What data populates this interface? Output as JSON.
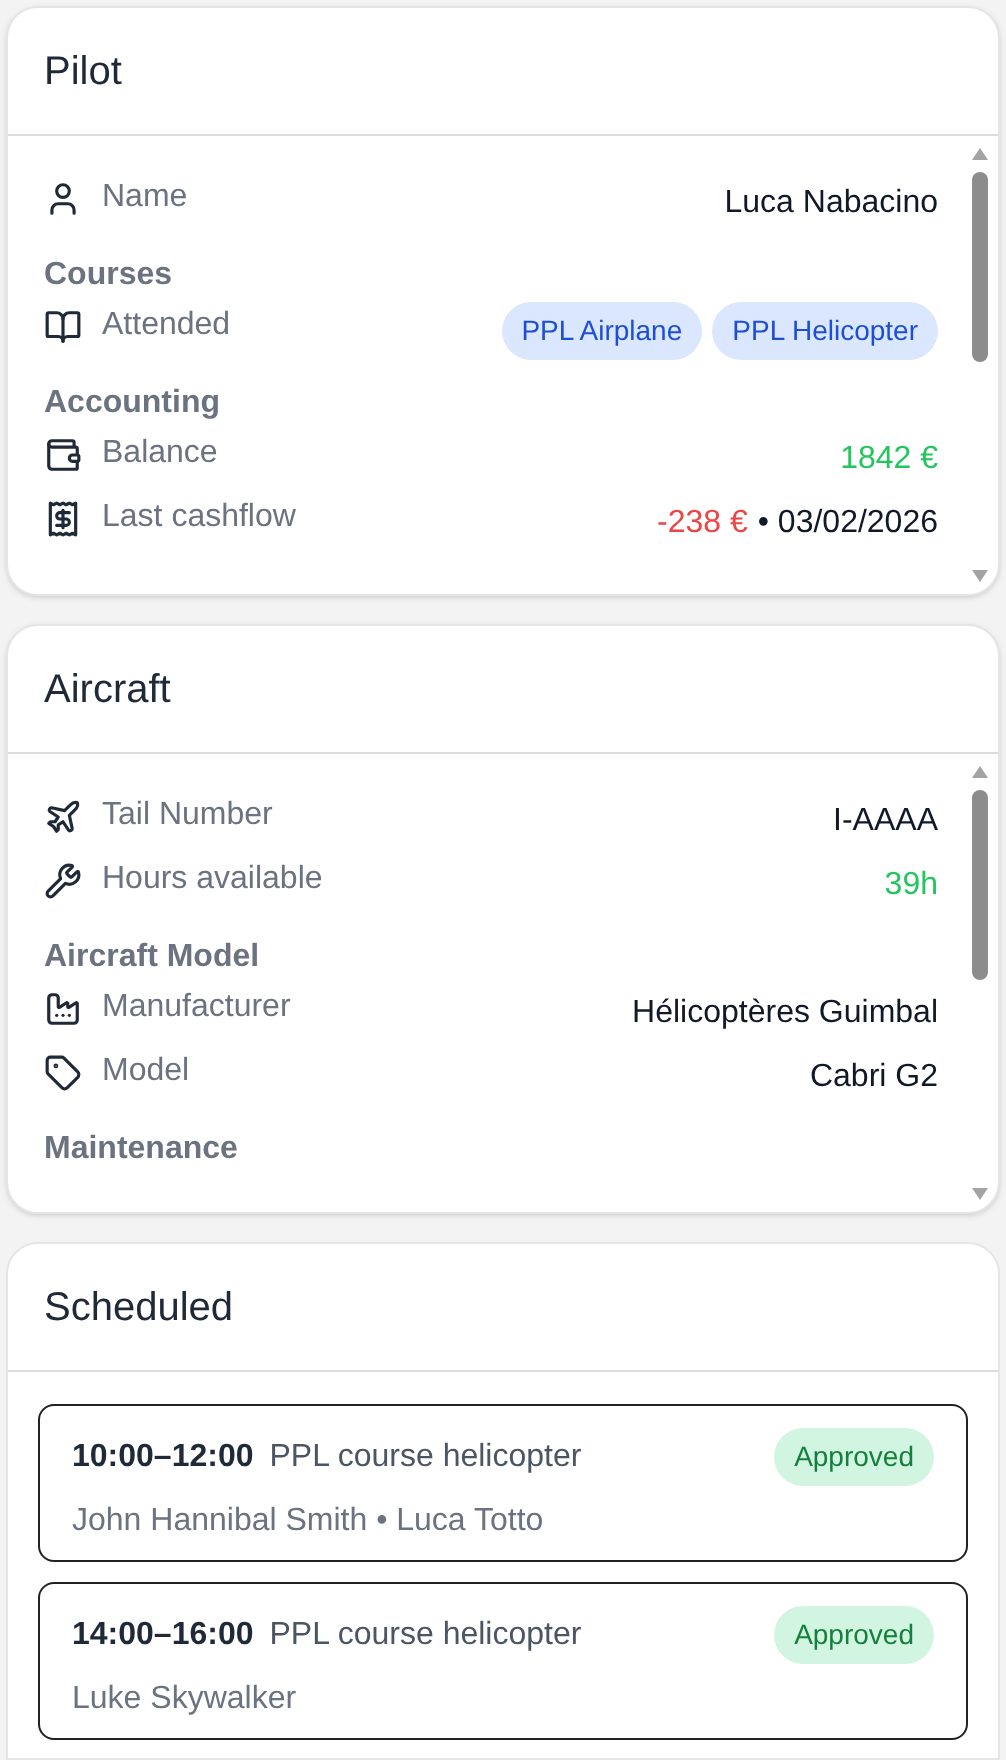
{
  "pilot": {
    "title": "Pilot",
    "rows": [
      {
        "kind": "field",
        "label": "Name",
        "value": [
          {
            "text": "Luca Nabacino",
            "color": "#111827"
          }
        ]
      },
      {
        "kind": "section",
        "label": "Courses"
      },
      {
        "kind": "chips",
        "label": "Attended",
        "chips": [
          "PPL Airplane",
          "PPL Helicopter"
        ]
      },
      {
        "kind": "section",
        "label": "Accounting"
      },
      {
        "kind": "field",
        "label": "Balance",
        "value": [
          {
            "text": "1842 €",
            "color": "#22c55e"
          }
        ]
      },
      {
        "kind": "field",
        "label": "Last cashflow",
        "value": [
          {
            "text": "-238 €",
            "color": "#ef4444"
          },
          {
            "text": "• 03/02/2026",
            "color": "#111827"
          }
        ]
      }
    ]
  },
  "aircraft": {
    "title": "Aircraft",
    "rows": [
      {
        "kind": "field",
        "label": "Tail Number",
        "value": [
          {
            "text": "I-AAAA",
            "color": "#111827"
          }
        ]
      },
      {
        "kind": "field",
        "label": "Hours available",
        "value": [
          {
            "text": "39h",
            "color": "#22c55e"
          }
        ]
      },
      {
        "kind": "section",
        "label": "Aircraft Model"
      },
      {
        "kind": "field",
        "label": "Manufacturer",
        "value": [
          {
            "text": "Hélicoptères Guimbal",
            "color": "#111827"
          }
        ]
      },
      {
        "kind": "field",
        "label": "Model",
        "value": [
          {
            "text": "Cabri G2",
            "color": "#111827"
          }
        ]
      },
      {
        "kind": "section",
        "label": "Maintenance"
      }
    ]
  },
  "scheduled": {
    "title": "Scheduled",
    "items": [
      {
        "time": "10:00–12:00",
        "title": "PPL course helicopter",
        "people": "John Hannibal Smith • Luca Totto",
        "status": "Approved"
      },
      {
        "time": "14:00–16:00",
        "title": "PPL course helicopter",
        "people": "Luke Skywalker",
        "status": "Approved"
      }
    ]
  }
}
